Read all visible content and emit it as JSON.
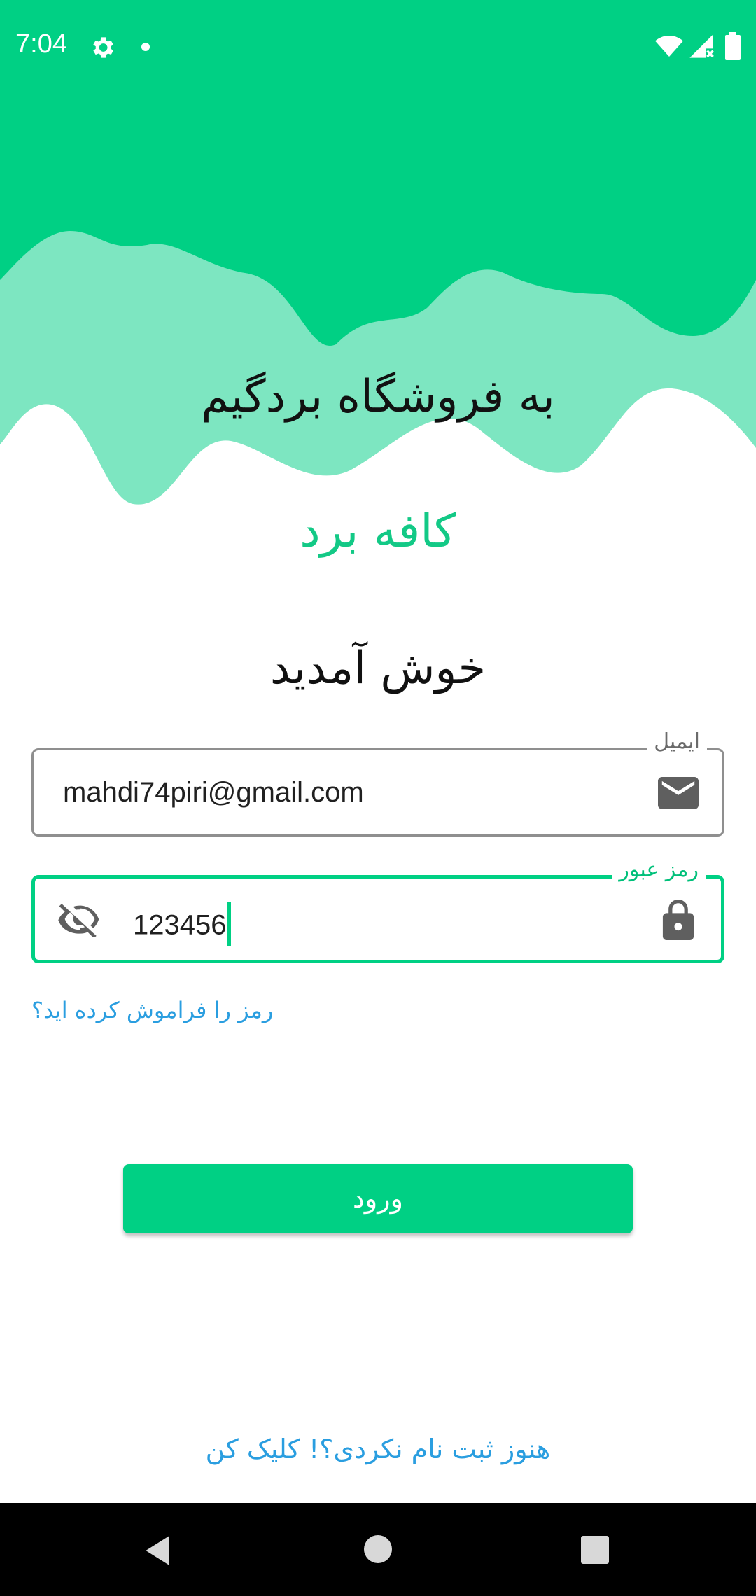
{
  "status_bar": {
    "time": "7:04"
  },
  "header": {
    "welcome_store": "به فروشگاه بردگیم",
    "brand": "کافه برد",
    "welcome": "خوش آمدید",
    "colors": {
      "dark_wave": "#00d084",
      "light_wave": "#7de6c1"
    }
  },
  "form": {
    "email": {
      "label": "ایمیل",
      "value": "mahdi74piri@gmail.com",
      "icon": "email-icon"
    },
    "password": {
      "label": "رمز عبور",
      "value": "123456",
      "icon": "lock-icon",
      "toggle_icon": "eye-off-icon"
    },
    "forgot_link": "رمز را فراموش کرده اید؟",
    "login_button": "ورود",
    "signup_link": "هنوز ثبت نام نکردی؟! کلیک کن"
  },
  "nav": {
    "back": "back-icon",
    "home": "home-icon",
    "recents": "recents-icon"
  }
}
